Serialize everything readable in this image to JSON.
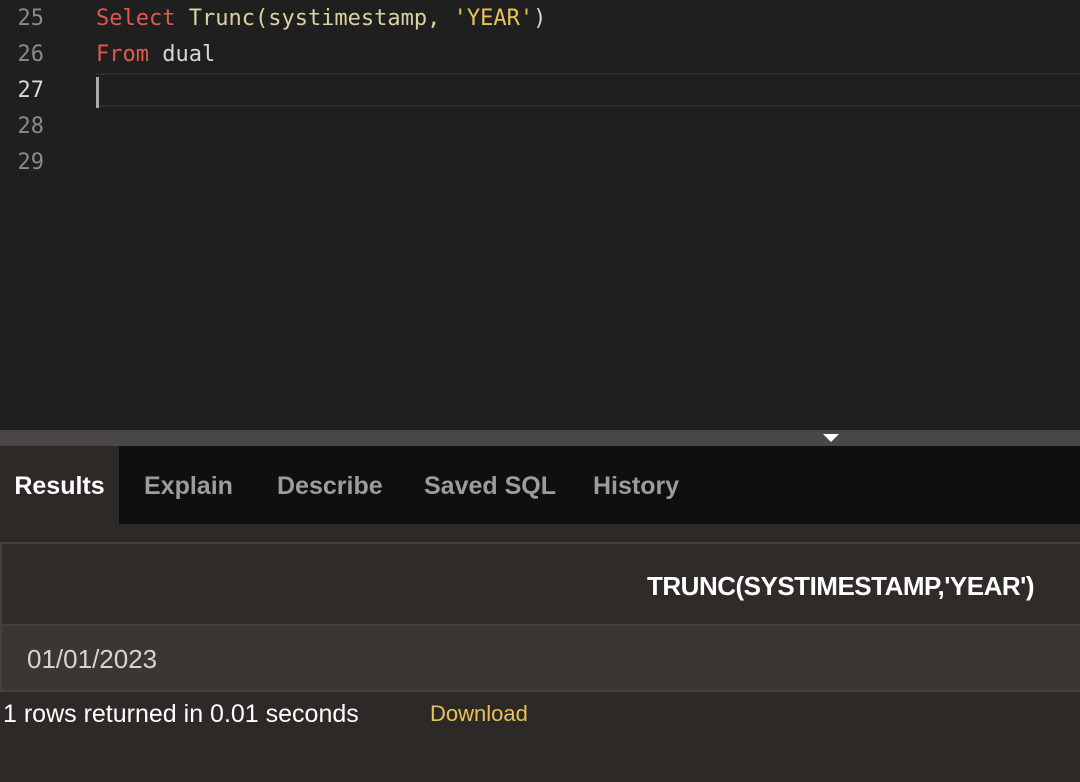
{
  "editor": {
    "lines": [
      {
        "number": "25",
        "tokens": {
          "kw": "Select",
          "fn": "Trunc(systimestamp, ",
          "str": "'YEAR'",
          "tail": ")"
        }
      },
      {
        "number": "26",
        "tokens": {
          "kw": "From",
          "rest": " dual"
        }
      },
      {
        "number": "27",
        "text": ""
      },
      {
        "number": "28",
        "text": ""
      },
      {
        "number": "29",
        "text": ""
      }
    ],
    "active_line": "27"
  },
  "tabs": [
    {
      "label": "Results",
      "active": true
    },
    {
      "label": "Explain"
    },
    {
      "label": "Describe"
    },
    {
      "label": "Saved SQL"
    },
    {
      "label": "History"
    }
  ],
  "results": {
    "columns": [
      "TRUNC(SYSTIMESTAMP,'YEAR')"
    ],
    "rows": [
      [
        "01/01/2023"
      ]
    ],
    "status": "1 rows returned in 0.01 seconds",
    "download_label": "Download"
  },
  "colors": {
    "keyword": "#e0584f",
    "function": "#d9d3a0",
    "string": "#e8c35a",
    "link": "#e7c257"
  }
}
